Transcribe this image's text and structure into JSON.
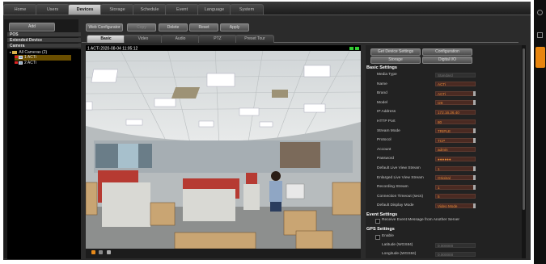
{
  "top_tabs": [
    "Home",
    "Users",
    "Devices",
    "Storage",
    "Schedule",
    "Event",
    "Language",
    "System"
  ],
  "left": {
    "add_label": "Add",
    "sections": [
      "POS",
      "Extended Device",
      "Camera"
    ],
    "tree": {
      "root": "All Cameras (2)",
      "cameras": [
        "1 ACTi",
        "2 ACTi"
      ]
    }
  },
  "toolbar": [
    "Web Configurator",
    "Copy",
    "Delete",
    "Reset",
    "Apply"
  ],
  "sub_tabs": [
    "Basic",
    "Video",
    "Audio",
    "PTZ",
    "Preset Tour"
  ],
  "video": {
    "overlay": "1 ACTi  2020-08-04 11:05:12"
  },
  "panel": {
    "buttons": [
      "Get Device Settings",
      "Configuration",
      "Storage",
      "Digital I/O"
    ],
    "basic_heading": "Basic Settings",
    "fields": [
      {
        "label": "Media Type",
        "value": "Standard",
        "dim": true
      },
      {
        "label": "Name",
        "value": "ACTi"
      },
      {
        "label": "Brand",
        "value": "ACTi",
        "spin": true
      },
      {
        "label": "Model",
        "value": "I28",
        "spin": true
      },
      {
        "label": "IP Address",
        "value": "172.16.26.40"
      },
      {
        "label": "HTTP Port",
        "value": "80"
      },
      {
        "label": "Stream Mode",
        "value": "TRIPLE",
        "spin": true
      },
      {
        "label": "Protocol",
        "value": "TCP",
        "spin": true
      },
      {
        "label": "Account",
        "value": "admin"
      },
      {
        "label": "Password",
        "value": "●●●●●●"
      },
      {
        "label": "Default Live View Stream",
        "value": "1",
        "spin": true
      },
      {
        "label": "Enlarged Live View Stream",
        "value": "Original",
        "spin": true
      },
      {
        "label": "Recording Stream",
        "value": "1",
        "spin": true
      },
      {
        "label": "Connection Timeout (secs)",
        "value": "5"
      },
      {
        "label": "Default Display Mode",
        "value": "Video Mode",
        "spin": true
      }
    ],
    "event_heading": "Event Settings",
    "event_check": "Receive Event Message from Another Server",
    "gps_heading": "GPS Settings",
    "gps_enable": "Enable",
    "gps_fields": [
      {
        "label": "Latitude (WGS84)",
        "value": "0.000000"
      },
      {
        "label": "Longitude (WGS84)",
        "value": "0.000000"
      }
    ]
  }
}
